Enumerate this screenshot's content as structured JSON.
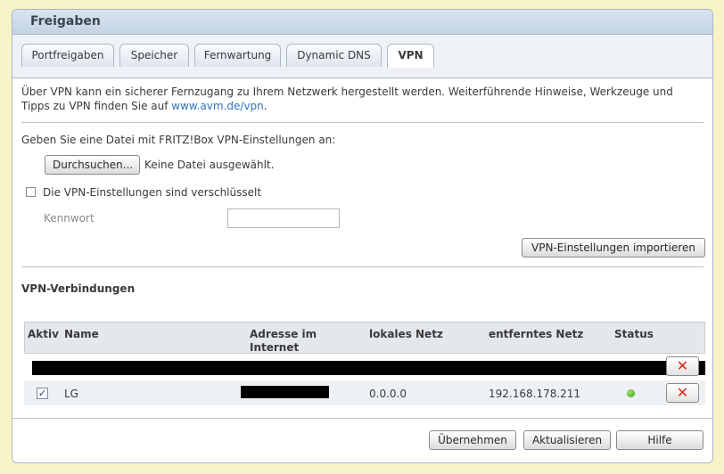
{
  "panel": {
    "title": "Freigaben"
  },
  "tabs": [
    {
      "label": "Portfreigaben",
      "active": false
    },
    {
      "label": "Speicher",
      "active": false
    },
    {
      "label": "Fernwartung",
      "active": false
    },
    {
      "label": "Dynamic DNS",
      "active": false
    },
    {
      "label": "VPN",
      "active": true
    }
  ],
  "intro": {
    "text": "Über VPN kann ein sicherer Fernzugang zu Ihrem Netzwerk hergestellt werden. Weiterführende Hinweise, Werkzeuge und Tipps zu VPN finden Sie auf ",
    "link": "www.avm.de/vpn",
    "suffix": "."
  },
  "import": {
    "file_prompt": "Geben Sie eine Datei mit FRITZ!Box VPN-Einstellungen an:",
    "browse_label": "Durchsuchen...",
    "no_file": "Keine Datei ausgewählt.",
    "encrypted_label": "Die VPN-Einstellungen sind verschlüsselt",
    "encrypted_checked": false,
    "password_label": "Kennwort",
    "password_value": "",
    "import_button": "VPN-Einstellungen importieren"
  },
  "connections": {
    "title": "VPN-Verbindungen",
    "columns": {
      "active": "Aktiv",
      "name": "Name",
      "address": "Adresse im Internet",
      "local": "lokales Netz",
      "remote": "entferntes Netz",
      "status": "Status"
    },
    "rows": [
      {
        "active": true,
        "name": "LG",
        "local": "0.0.0.0",
        "remote": "192.168.178.211",
        "status_color": "#4caf2a"
      }
    ]
  },
  "footer": {
    "apply": "Übernehmen",
    "refresh": "Aktualisieren",
    "help": "Hilfe"
  }
}
